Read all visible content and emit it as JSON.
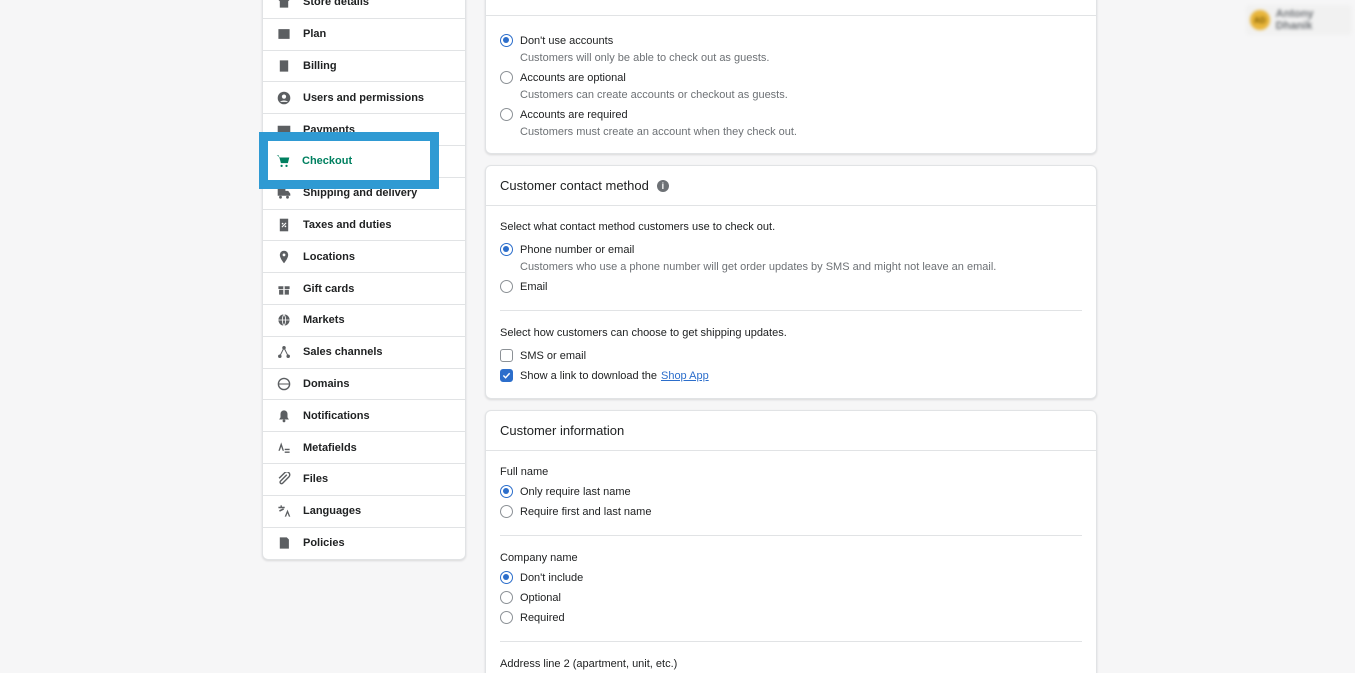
{
  "sidebar": {
    "items": [
      {
        "label": "Store details",
        "icon": "store-icon"
      },
      {
        "label": "Plan",
        "icon": "plan-icon"
      },
      {
        "label": "Billing",
        "icon": "billing-icon"
      },
      {
        "label": "Users and permissions",
        "icon": "user-icon"
      },
      {
        "label": "Payments",
        "icon": "payments-icon"
      },
      {
        "label": "Checkout",
        "icon": "cart-icon",
        "active": true
      },
      {
        "label": "Shipping and delivery",
        "icon": "truck-icon"
      },
      {
        "label": "Taxes and duties",
        "icon": "taxes-icon"
      },
      {
        "label": "Locations",
        "icon": "location-icon"
      },
      {
        "label": "Gift cards",
        "icon": "gift-icon"
      },
      {
        "label": "Markets",
        "icon": "globe-icon"
      },
      {
        "label": "Sales channels",
        "icon": "channels-icon"
      },
      {
        "label": "Domains",
        "icon": "domains-icon"
      },
      {
        "label": "Notifications",
        "icon": "bell-icon"
      },
      {
        "label": "Metafields",
        "icon": "metafields-icon"
      },
      {
        "label": "Files",
        "icon": "paperclip-icon"
      },
      {
        "label": "Languages",
        "icon": "language-icon"
      },
      {
        "label": "Policies",
        "icon": "policies-icon"
      }
    ]
  },
  "accounts": {
    "options": [
      {
        "label": "Don't use accounts",
        "help": "Customers will only be able to check out as guests.",
        "selected": true
      },
      {
        "label": "Accounts are optional",
        "help": "Customers can create accounts or checkout as guests.",
        "selected": false
      },
      {
        "label": "Accounts are required",
        "help": "Customers must create an account when they check out.",
        "selected": false
      }
    ]
  },
  "contact": {
    "title": "Customer contact method",
    "select_label": "Select what contact method customers use to check out.",
    "options": [
      {
        "label": "Phone number or email",
        "help": "Customers who use a phone number will get order updates by SMS and might not leave an email.",
        "selected": true
      },
      {
        "label": "Email",
        "selected": false
      }
    ],
    "updates_label": "Select how customers can choose to get shipping updates.",
    "checks": [
      {
        "label": "SMS or email",
        "checked": false
      },
      {
        "label": "Show a link to download the",
        "link": "Shop App",
        "checked": true
      }
    ]
  },
  "info": {
    "title": "Customer information",
    "full_name_label": "Full name",
    "full_name_options": [
      {
        "label": "Only require last name",
        "selected": true
      },
      {
        "label": "Require first and last name",
        "selected": false
      }
    ],
    "company_label": "Company name",
    "company_options": [
      {
        "label": "Don't include",
        "selected": true
      },
      {
        "label": "Optional",
        "selected": false
      },
      {
        "label": "Required",
        "selected": false
      }
    ],
    "address_label": "Address line 2 (apartment, unit, etc.)"
  },
  "user": {
    "initials": "AD",
    "name": "Antony Dhanik"
  },
  "colors": {
    "accent": "#008060",
    "highlight": "#2f9ad3",
    "link": "#2c6ecb"
  }
}
